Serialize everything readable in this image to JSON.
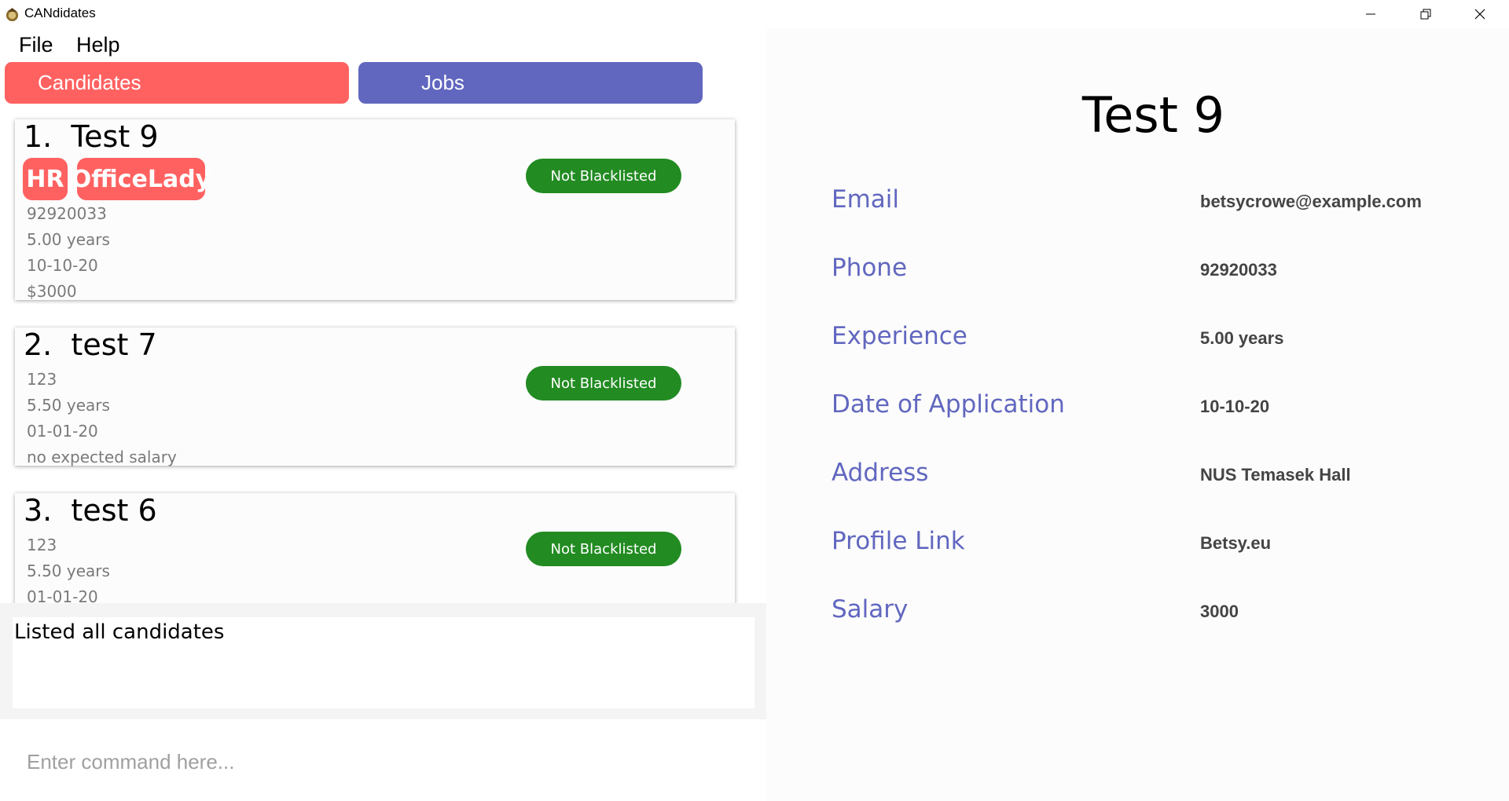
{
  "window": {
    "title": "CANdidates",
    "controls": [
      "minimize",
      "restore",
      "close"
    ]
  },
  "menu": {
    "file": "File",
    "help": "Help"
  },
  "tabs": {
    "candidates": "Candidates",
    "jobs": "Jobs"
  },
  "colors": {
    "candidates_tab": "#ff6161",
    "jobs_tab": "#6167bf",
    "tag": "#ff6161",
    "blacklist_badge": "#228b22",
    "detail_label": "#6167bf"
  },
  "candidates": [
    {
      "name": "1.  Test 9",
      "tags": [
        "HR",
        "OfficeLady"
      ],
      "phone": "92920033",
      "experience": "5.00 years",
      "date": "10-10-20",
      "salary": "$3000",
      "status": "Not Blacklisted"
    },
    {
      "name": "2.  test 7",
      "tags": [],
      "phone": "123",
      "experience": "5.50 years",
      "date": "01-01-20",
      "salary": "no expected salary",
      "status": "Not Blacklisted"
    },
    {
      "name": "3.  test 6",
      "tags": [],
      "phone": "123",
      "experience": "5.50 years",
      "date": "01-01-20",
      "status": "Not Blacklisted"
    }
  ],
  "result": {
    "text": "Listed all candidates"
  },
  "command": {
    "placeholder": "Enter command here..."
  },
  "detail": {
    "name": "Test 9",
    "labels": {
      "email": "Email",
      "phone": "Phone",
      "experience": "Experience",
      "date": "Date of Application",
      "address": "Address",
      "profile": "Profile Link",
      "salary": "Salary"
    },
    "values": {
      "email": "betsycrowe@example.com",
      "phone": "92920033",
      "experience": "5.00 years",
      "date": "10-10-20",
      "address": "NUS Temasek Hall",
      "profile": "Betsy.eu",
      "salary": "3000"
    }
  }
}
